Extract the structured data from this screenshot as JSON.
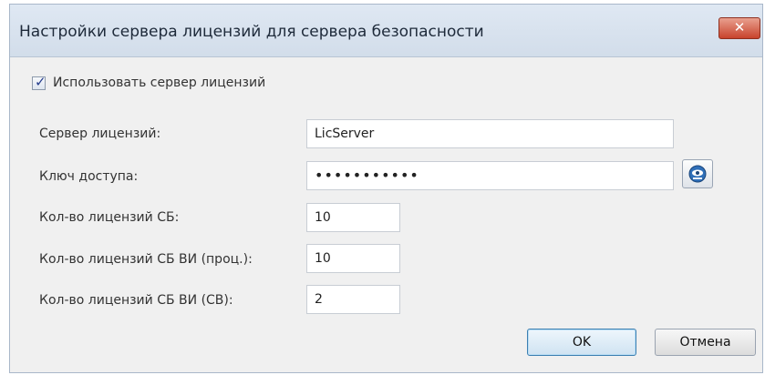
{
  "window": {
    "title": "Настройки сервера лицензий для сервера безопасности",
    "close_glyph": "✕"
  },
  "use_license_server": {
    "label": "Использовать сервер лицензий",
    "checked": true,
    "tick": "✓"
  },
  "fields": {
    "server": {
      "label": "Сервер лицензий:",
      "value": "LicServer"
    },
    "access_key": {
      "label": "Ключ доступа:",
      "value": "•••••••••••"
    },
    "sb_count": {
      "label": "Кол-во лицензий СБ:",
      "value": "10"
    },
    "sb_vi_proc": {
      "label": "Кол-во лицензий СБ ВИ (проц.):",
      "value": "10"
    },
    "sb_vi_sv": {
      "label": "Кол-во лицензий СБ ВИ (СВ):",
      "value": "2"
    }
  },
  "buttons": {
    "ok": "OK",
    "cancel": "Отмена"
  },
  "icons": {
    "close": "close-icon",
    "key": "show-password-icon"
  },
  "colors": {
    "close_button": "#c8432c",
    "ok_border": "#3c7fb1"
  }
}
